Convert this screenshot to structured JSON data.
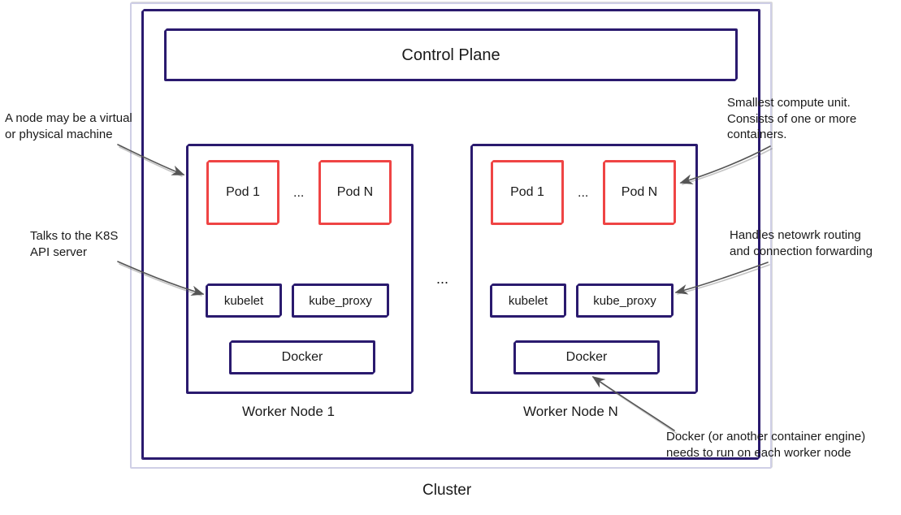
{
  "diagram": {
    "title": "Cluster",
    "control_plane": "Control Plane",
    "ellipsis": "...",
    "worker1": {
      "title": "Worker Node 1",
      "pod1": "Pod 1",
      "podN": "Pod N",
      "kubelet": "kubelet",
      "kubeproxy": "kube_proxy",
      "docker": "Docker"
    },
    "workerN": {
      "title": "Worker Node N",
      "pod1": "Pod 1",
      "podN": "Pod N",
      "kubelet": "kubelet",
      "kubeproxy": "kube_proxy",
      "docker": "Docker"
    },
    "annotations": {
      "node": "A node may be a virtual\nor physical machine",
      "kubelet": "Talks to the K8S\nAPI server",
      "pod": "Smallest compute unit.\nConsists of one or more\ncontainers.",
      "kubeproxy": "Handles netowrk routing\nand connection forwarding",
      "docker": "Docker (or another container engine)\nneeds to run on each worker node"
    }
  },
  "colors": {
    "outer_border": "#cfcfe6",
    "cluster_border": "#2a1a6e",
    "box_border": "#2a1a6e",
    "pod_border": "#ef4444",
    "text": "#1a1a1a"
  }
}
